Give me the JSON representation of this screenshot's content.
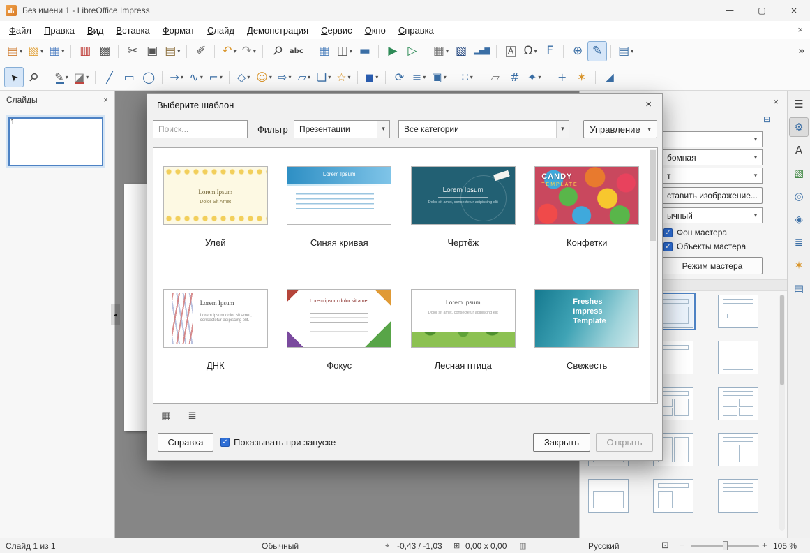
{
  "ui": {
    "caret": "▾",
    "check": "✓",
    "collapse_arrow": "◂"
  },
  "titlebar": {
    "title": "Без имени 1 - LibreOffice Impress",
    "minimize": "—",
    "maximize": "▢",
    "close": "×"
  },
  "menubar": {
    "items": [
      "Файл",
      "Правка",
      "Вид",
      "Вставка",
      "Формат",
      "Слайд",
      "Демонстрация",
      "Сервис",
      "Окно",
      "Справка"
    ],
    "close_document": "×"
  },
  "toolbar_main": {
    "overflow": "»",
    "items": [
      {
        "name": "new-presentation-icon",
        "glyph": "▤",
        "color": "#cf7b2e",
        "dd": true
      },
      {
        "name": "open-icon",
        "glyph": "▧",
        "color": "#e2a33d",
        "dd": true
      },
      {
        "name": "save-icon",
        "glyph": "▦",
        "color": "#4f7fc2",
        "dd": true
      },
      {
        "name": "export-pdf-icon",
        "glyph": "▥",
        "color": "#c14540",
        "grp": true
      },
      {
        "name": "print-icon",
        "glyph": "▩",
        "color": "#5a5a5a"
      },
      {
        "name": "cut-icon",
        "glyph": "✂",
        "color": "#555555",
        "grp": true
      },
      {
        "name": "copy-icon",
        "glyph": "▣",
        "color": "#555555"
      },
      {
        "name": "paste-icon",
        "glyph": "▤",
        "color": "#8a6d3b",
        "dd": true
      },
      {
        "name": "clone-formatting-icon",
        "glyph": "✐",
        "color": "#555555",
        "grp": true
      },
      {
        "name": "undo-icon",
        "glyph": "↶",
        "color": "#d9952b",
        "dd": true,
        "grp": true
      },
      {
        "name": "redo-icon",
        "glyph": "↷",
        "color": "#8f8f8f",
        "dd": true
      },
      {
        "name": "find-replace-icon",
        "glyph": "⚲",
        "color": "#444444",
        "rot45": true,
        "grp": true
      },
      {
        "name": "spelling-icon",
        "glyph": "abc",
        "color": "#444444",
        "small": true
      },
      {
        "name": "display-grid-icon",
        "glyph": "▦",
        "color": "#4a7ebb",
        "grp": true
      },
      {
        "name": "display-views-icon",
        "glyph": "◫",
        "color": "#555555",
        "dd": true
      },
      {
        "name": "master-slide-icon",
        "glyph": "▬",
        "color": "#3a6ea5"
      },
      {
        "name": "start-first-slide-icon",
        "glyph": "▶",
        "color": "#2e8b57",
        "grp": true
      },
      {
        "name": "start-current-slide-icon",
        "glyph": "▷",
        "color": "#2e8b57"
      },
      {
        "name": "insert-table-icon",
        "glyph": "▦",
        "color": "#777777",
        "dd": true,
        "grp": true
      },
      {
        "name": "insert-image-icon",
        "glyph": "▧",
        "color": "#24477f"
      },
      {
        "name": "insert-chart-icon",
        "glyph": "▂▅▇",
        "color": "#3a6ea5",
        "small": true
      },
      {
        "name": "insert-textbox-icon",
        "glyph": "A",
        "color": "#444444",
        "boxed": true,
        "grp": true
      },
      {
        "name": "special-char-icon",
        "glyph": "Ω",
        "color": "#444444",
        "dd": true
      },
      {
        "name": "fontwork-icon",
        "glyph": "F",
        "color": "#3a6ea5"
      },
      {
        "name": "hyperlink-icon",
        "glyph": "⊕",
        "color": "#3a6ea5",
        "grp": true
      },
      {
        "name": "draw-functions-icon",
        "glyph": "✎",
        "color": "#3a6ea5",
        "active": true
      },
      {
        "name": "new-slide-icon",
        "glyph": "▤",
        "color": "#3a6ea5",
        "dd": true,
        "grp": true
      }
    ]
  },
  "toolbar_draw": {
    "items": [
      {
        "name": "select-icon",
        "glyph": "➤",
        "color": "#222222",
        "rot135": true,
        "active": true
      },
      {
        "name": "zoom-icon",
        "glyph": "⚲",
        "color": "#444444",
        "rot45": true
      },
      {
        "name": "line-color-icon",
        "glyph": "✎",
        "color": "#555555",
        "bar": "#3a6ea5",
        "dd": true,
        "grp": true
      },
      {
        "name": "fill-color-icon",
        "glyph": "◪",
        "color": "#777777",
        "bar": "#c14540",
        "dd": true
      },
      {
        "name": "insert-line-icon",
        "glyph": "╱",
        "color": "#3a6ea5",
        "grp": true
      },
      {
        "name": "rectangle-icon",
        "glyph": "▭",
        "color": "#3a6ea5"
      },
      {
        "name": "ellipse-icon",
        "glyph": "◯",
        "color": "#3a6ea5"
      },
      {
        "name": "lines-arrows-icon",
        "glyph": "→",
        "color": "#3a6ea5",
        "dd": true,
        "grp": true
      },
      {
        "name": "curve-icon",
        "glyph": "∿",
        "color": "#3a6ea5",
        "dd": true
      },
      {
        "name": "connectors-icon",
        "glyph": "⌐",
        "color": "#3a6ea5",
        "dd": true
      },
      {
        "name": "basic-shapes-icon",
        "glyph": "◇",
        "color": "#3a6ea5",
        "dd": true,
        "grp": true
      },
      {
        "name": "symbol-shapes-icon",
        "glyph": "☺",
        "color": "#d9952b",
        "dd": true
      },
      {
        "name": "block-arrows-icon",
        "glyph": "⇨",
        "color": "#3a6ea5",
        "dd": true
      },
      {
        "name": "flowchart-icon",
        "glyph": "▱",
        "color": "#3a6ea5",
        "dd": true
      },
      {
        "name": "callouts-icon",
        "glyph": "❏",
        "color": "#3a6ea5",
        "dd": true
      },
      {
        "name": "stars-icon",
        "glyph": "☆",
        "color": "#d9952b",
        "dd": true
      },
      {
        "name": "3d-objects-icon",
        "glyph": "◼",
        "color": "#2a5db0",
        "dd": true,
        "grp": true
      },
      {
        "name": "rotate-icon",
        "glyph": "⟳",
        "color": "#3a6ea5",
        "grp": true
      },
      {
        "name": "align-icon",
        "glyph": "≡",
        "color": "#3a6ea5",
        "dd": true
      },
      {
        "name": "arrange-icon",
        "glyph": "▣",
        "color": "#3a6ea5",
        "dd": true
      },
      {
        "name": "distribute-icon",
        "glyph": "∷",
        "color": "#3a6ea5",
        "dd": true,
        "grp": true
      },
      {
        "name": "shadow-icon",
        "glyph": "▱",
        "color": "#777777",
        "grp": true
      },
      {
        "name": "crop-icon",
        "glyph": "#",
        "color": "#3a6ea5"
      },
      {
        "name": "image-filter-icon",
        "glyph": "✦",
        "color": "#3a6ea5",
        "dd": true
      },
      {
        "name": "edit-points-icon",
        "glyph": "+",
        "color": "#3a6ea5",
        "grp": true
      },
      {
        "name": "glue-points-icon",
        "glyph": "✶",
        "color": "#d9952b"
      },
      {
        "name": "extrusion-icon",
        "glyph": "◢",
        "color": "#3a6ea5",
        "grp": true
      }
    ]
  },
  "slides_panel": {
    "title": "Слайды",
    "close_icon": "×",
    "slides": [
      {
        "number": "1"
      }
    ]
  },
  "dialog": {
    "title": "Выберите шаблон",
    "close_icon": "×",
    "search_placeholder": "Поиск...",
    "filter_label": "Фильтр",
    "filter_type_value": "Презентации",
    "category_value": "Все категории",
    "manage_label": "Управление",
    "grid_view_icon": "▦",
    "list_view_icon": "≣",
    "help_label": "Справка",
    "show_on_startup_label": "Показывать при запуске",
    "close_label": "Закрыть",
    "open_label": "Открыть",
    "templates": [
      {
        "name": "Улей",
        "title": "Lorem Ipsum",
        "subtitle": "Dolor Sit Amet"
      },
      {
        "name": "Синяя кривая",
        "title": "Lorem Ipsum"
      },
      {
        "name": "Чертёж",
        "title": "Lorem Ipsum",
        "subtitle": "Dolor sit amet, consectetur adipiscing elit"
      },
      {
        "name": "Конфетки",
        "title": "CANDY",
        "subtitle": "TEMPLATE"
      },
      {
        "name": "ДНК",
        "title": "Lorem Ipsum",
        "subtitle": "Lorem ipsum dolor sit amet, consectetur adipiscing elit."
      },
      {
        "name": "Фокус",
        "title": "Lorem ipsum dolor sit amet"
      },
      {
        "name": "Лесная птица",
        "title": "Lorem Ipsum",
        "subtitle": "Dolor sit amet, consectetur adipiscing elit"
      },
      {
        "name": "Свежесть",
        "title": "Freshes Impress Template"
      }
    ]
  },
  "sidebar": {
    "close_icon": "×",
    "deck_menu_icon": "⊟",
    "combo1_text": "",
    "combo2_text": "бомная",
    "combo3_text": "т",
    "insert_image_label": "ставить изображение...",
    "background_combo_text": "ычный",
    "master_bg_label": "Фон мастера",
    "master_objects_label": "Объекты мастера",
    "master_mode_label": "Режим мастера"
  },
  "icon_strip": {
    "items": [
      {
        "name": "sidebar-settings-icon",
        "glyph": "☰",
        "color": "#444444"
      },
      {
        "name": "properties-deck-icon",
        "glyph": "⚙",
        "color": "#3a6ea5",
        "active": true
      },
      {
        "name": "styles-deck-icon",
        "glyph": "A",
        "color": "#444444"
      },
      {
        "name": "gallery-deck-icon",
        "glyph": "▧",
        "color": "#2e7d32"
      },
      {
        "name": "navigator-deck-icon",
        "glyph": "◎",
        "color": "#3a6ea5"
      },
      {
        "name": "transitions-deck-icon",
        "glyph": "◈",
        "color": "#3a6ea5"
      },
      {
        "name": "animation-deck-icon",
        "glyph": "≣",
        "color": "#3a6ea5"
      },
      {
        "name": "effects-deck-icon",
        "glyph": "✶",
        "color": "#d9952b"
      },
      {
        "name": "master-slides-deck-icon",
        "glyph": "▤",
        "color": "#3a6ea5"
      }
    ]
  },
  "statusbar": {
    "slide_info": "Слайд 1 из 1",
    "view_mode": "Обычный",
    "position_icon": "⌖",
    "position": "-0,43 / -1,03",
    "dimensions_icon": "⊞",
    "dimensions": "0,00 x 0,00",
    "modified_icon": "▥",
    "language": "Русский",
    "fit_icon": "⊡",
    "zoom_out": "−",
    "zoom_in": "+",
    "zoom_value": "105 %"
  }
}
